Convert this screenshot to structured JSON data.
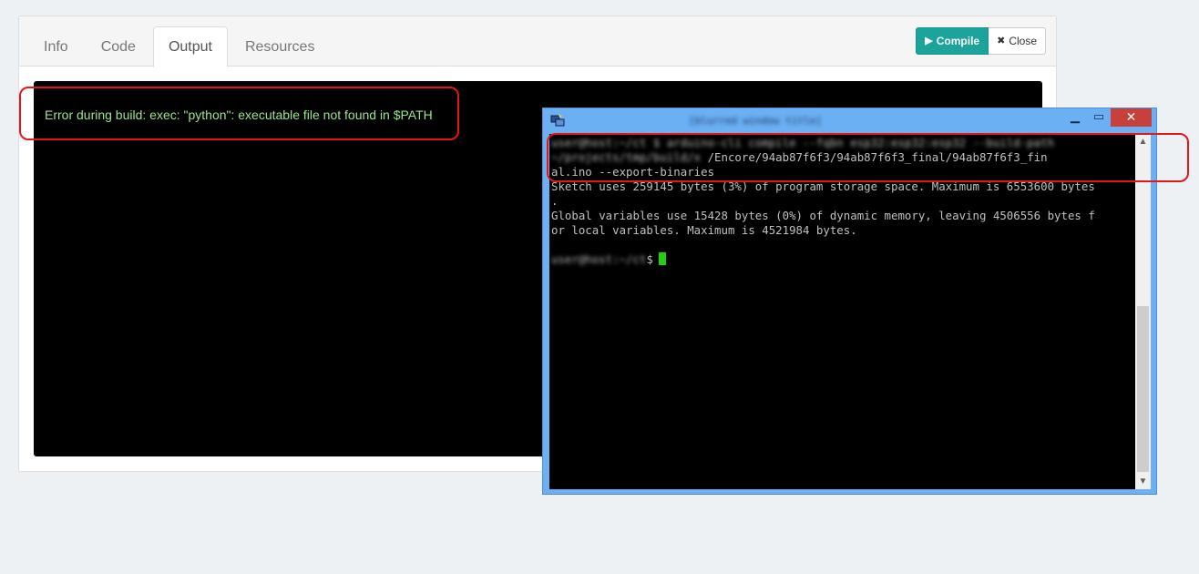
{
  "tabs": [
    {
      "label": "Info",
      "active": false
    },
    {
      "label": "Code",
      "active": false
    },
    {
      "label": "Output",
      "active": true
    },
    {
      "label": "Resources",
      "active": false
    }
  ],
  "toolbar": {
    "compile_label": "Compile",
    "compile_icon": "play-icon",
    "close_label": "Close",
    "close_icon": "x-icon"
  },
  "output": {
    "error_text": "Error during build: exec: \"python\": executable file not found in $PATH"
  },
  "terminal": {
    "title": "[blurred window title]",
    "lines": [
      "/Encore/94ab87f6f3/94ab87f6f3_final/94ab87f6f3_fin",
      "al.ino --export-binaries",
      "Sketch uses 259145 bytes (3%) of program storage space. Maximum is 6553600 bytes",
      ".",
      "Global variables use 15428 bytes (0%) of dynamic memory, leaving 4506556 bytes f",
      "or local variables. Maximum is 4521984 bytes."
    ],
    "prompt_symbol": "$"
  },
  "colors": {
    "accent": "#1ba39c",
    "output_text": "#9ce58a",
    "highlight_box": "#e3161c",
    "terminal_frame": "#6ab0f3",
    "cursor": "#22d10c"
  }
}
